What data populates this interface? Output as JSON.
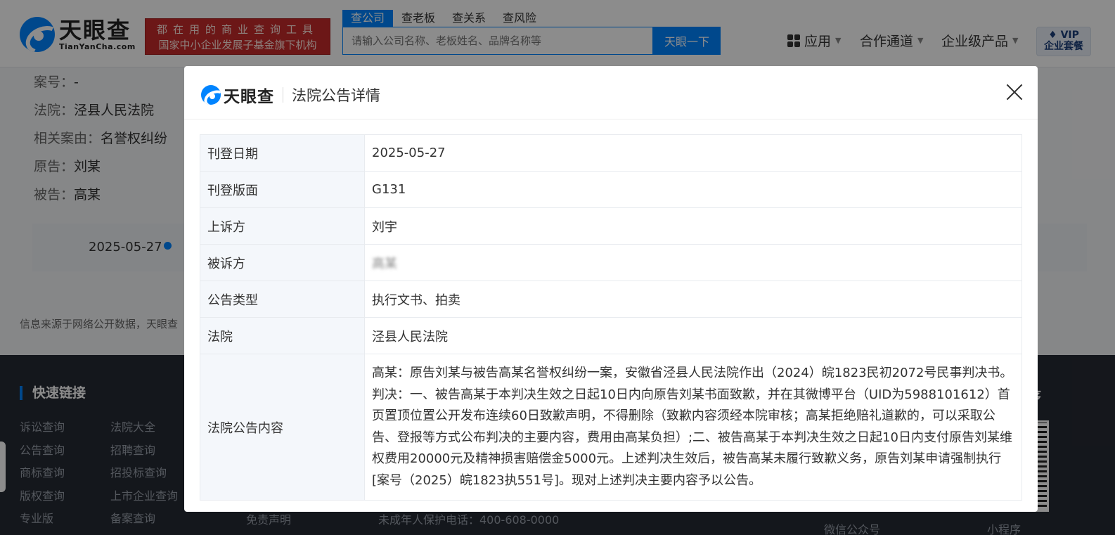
{
  "header": {
    "logo_cn": "天眼查",
    "logo_en": "TianYanCha.com",
    "slogan_line1": "都在用的商业查询工具",
    "slogan_line2": "国家中小企业发展子基金旗下机构",
    "search_tabs": [
      "查公司",
      "查老板",
      "查关系",
      "查风险"
    ],
    "search_placeholder": "请输入公司名称、老板姓名、品牌名称等",
    "search_button": "天眼一下",
    "nav": [
      "应用",
      "合作通道",
      "企业级产品"
    ],
    "vip_line1": "VIP",
    "vip_line2": "企业套餐"
  },
  "background": {
    "case_no_label": "案号：",
    "case_no": "-",
    "court_label": "法院：",
    "court": "泾县人民法院",
    "cause_label": "相关案由：",
    "cause": "名誉权纠纷",
    "plaintiff_label": "原告：",
    "plaintiff": "刘某",
    "defendant_label": "被告：",
    "defendant": "高某",
    "timeline_date": "2025-05-27",
    "source_note": "信息来源于网络公开数据，天眼查"
  },
  "footer": {
    "title": "快速链接",
    "links_col1": [
      "诉讼查询",
      "公告查询",
      "商标查询",
      "版权查询",
      "专业版"
    ],
    "links_col2": [
      "法院大全",
      "招聘查询",
      "招投标查询",
      "上市企业查询",
      "备案查询"
    ],
    "disclaimer": "免责声明",
    "hotline": "未成年人保护电话：400-608-0000",
    "wechat": "微信公众号",
    "miniapp": "小程序",
    "right_title": "序"
  },
  "modal": {
    "logo_text": "天眼查",
    "title": "法院公告详情",
    "rows": [
      {
        "label": "刊登日期",
        "value": "2025-05-27"
      },
      {
        "label": "刊登版面",
        "value": "G131"
      },
      {
        "label": "上诉方",
        "value": "刘宇"
      },
      {
        "label": "被诉方",
        "value": "高某"
      },
      {
        "label": "公告类型",
        "value": "执行文书、拍卖"
      },
      {
        "label": "法院",
        "value": "泾县人民法院"
      }
    ],
    "content_label": "法院公告内容",
    "content": "高某：原告刘某与被告高某名誉权纠纷一案，安徽省泾县人民法院作出（2024）皖1823民初2072号民事判决书。判决：一、被告高某于本判决生效之日起10日内向原告刘某书面致歉，并在其微博平台（UID为5988101612）首页置顶位置公开发布连续60日致歉声明，不得删除（致歉内容须经本院审核；高某拒绝赔礼道歉的，可以采取公告、登报等方式公布判决的主要内容，费用由高某负担）;二、被告高某于本判决生效之日起10日内支付原告刘某维权费用20000元及精神损害赔偿金5000元。上述判决生效后，被告高某未履行致歉义务，原告刘某申请强制执行[案号（2025）皖1823执551号]。现对上述判决主要内容予以公告。"
  }
}
